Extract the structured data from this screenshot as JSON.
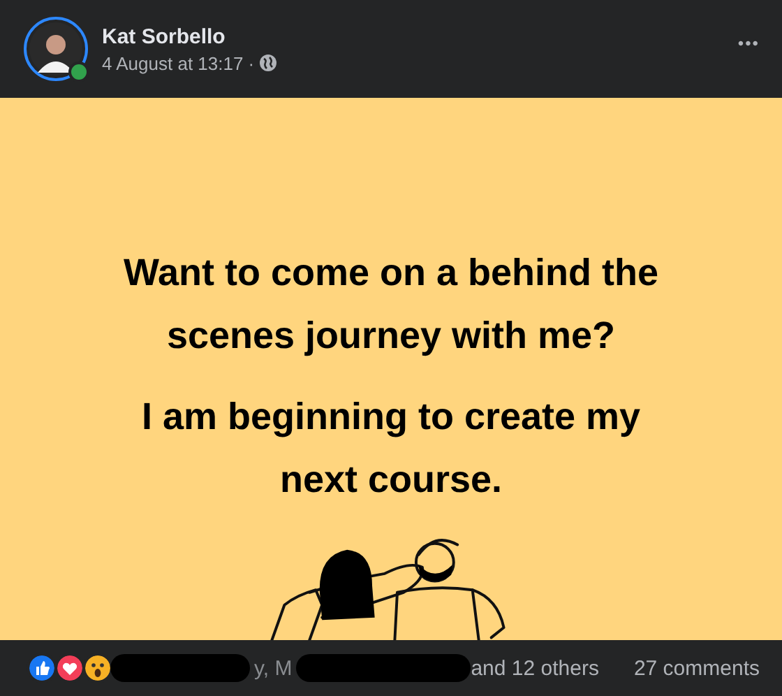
{
  "post": {
    "author": "Kat Sorbello",
    "online": true,
    "timestamp": "4 August at 13:17 ·",
    "more": "•••"
  },
  "image": {
    "paragraphs": [
      "Want to come on a behind the scenes journey with me?",
      "I am beginning to create my next course."
    ]
  },
  "footer": {
    "reactions": [
      {
        "kind": "like"
      },
      {
        "kind": "love"
      },
      {
        "kind": "wow"
      }
    ],
    "name_fragment": "y, M",
    "others": "and 12 others",
    "comments": "27 comments"
  }
}
